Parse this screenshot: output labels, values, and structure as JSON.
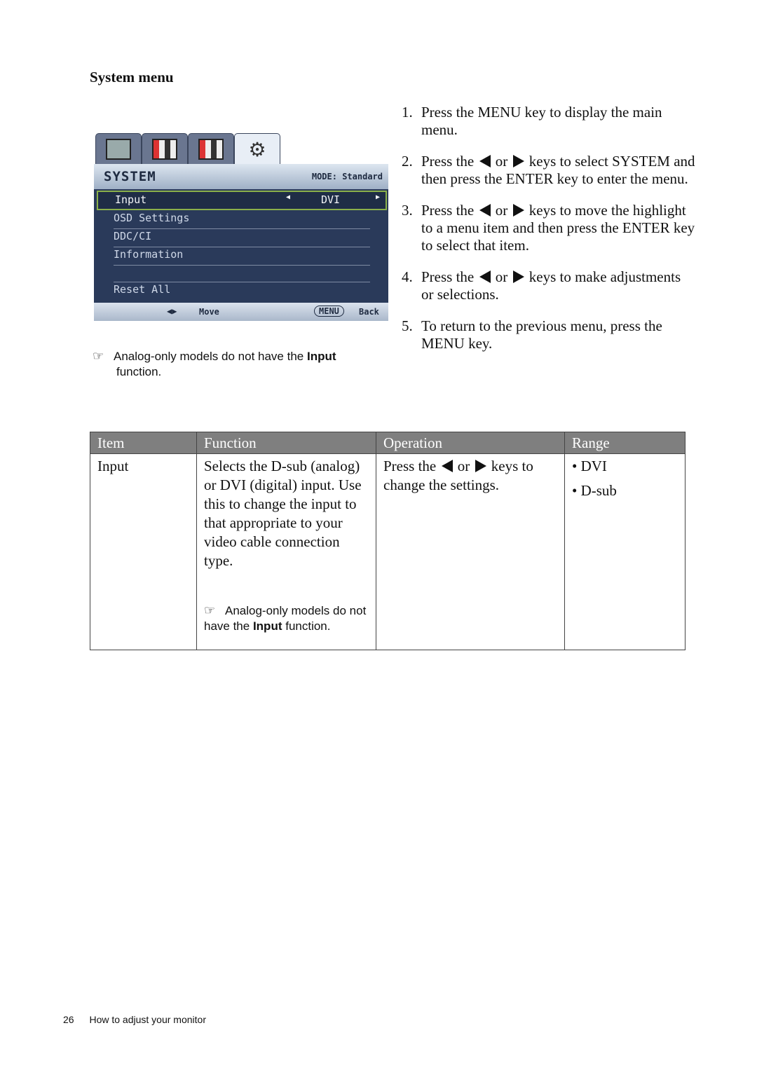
{
  "heading": "System menu",
  "osd": {
    "title": "SYSTEM",
    "mode": "MODE: Standard",
    "tabs": [
      "display-tab",
      "picture-tab",
      "picture-advanced-tab",
      "system-tab"
    ],
    "items": [
      "Input",
      "OSD Settings",
      "DDC/CI",
      "Information",
      "",
      "Reset All"
    ],
    "selected_value": "DVI",
    "footer_move": "Move",
    "footer_menu": "MENU",
    "footer_back": "Back"
  },
  "note": {
    "pre": "Analog-only models do not have the ",
    "bold": "Input",
    "post": "function."
  },
  "steps": [
    {
      "num": "1.",
      "parts": [
        "Press the MENU key to display the main menu."
      ]
    },
    {
      "num": "2.",
      "parts": [
        "Press the ",
        "or",
        " keys to select SYSTEM and then press the ENTER key to enter the menu."
      ]
    },
    {
      "num": "3.",
      "parts": [
        "Press the ",
        "or",
        " keys to move the highlight to a menu item and then press the ENTER key to select that item."
      ]
    },
    {
      "num": "4.",
      "parts": [
        "Press the ",
        "or",
        " keys to make adjustments or selections."
      ]
    },
    {
      "num": "5.",
      "parts": [
        "To return to the previous menu, press the MENU key."
      ]
    }
  ],
  "table": {
    "headers": [
      "Item",
      "Function",
      "Operation",
      "Range"
    ],
    "row": {
      "item": "Input",
      "function": "Selects the D-sub (analog) or DVI (digital) input. Use this to change the input to that appropriate to your video cable connection type.",
      "function_note_pre": "Analog-only models do not have the ",
      "function_note_bold": "Input",
      "function_note_post": " function.",
      "operation_pre": "Press the ",
      "operation_or": "or",
      "operation_post": " keys to change the settings.",
      "range": [
        "• DVI",
        "• D-sub"
      ]
    }
  },
  "footer": {
    "page": "26",
    "title": "How to adjust your monitor"
  }
}
